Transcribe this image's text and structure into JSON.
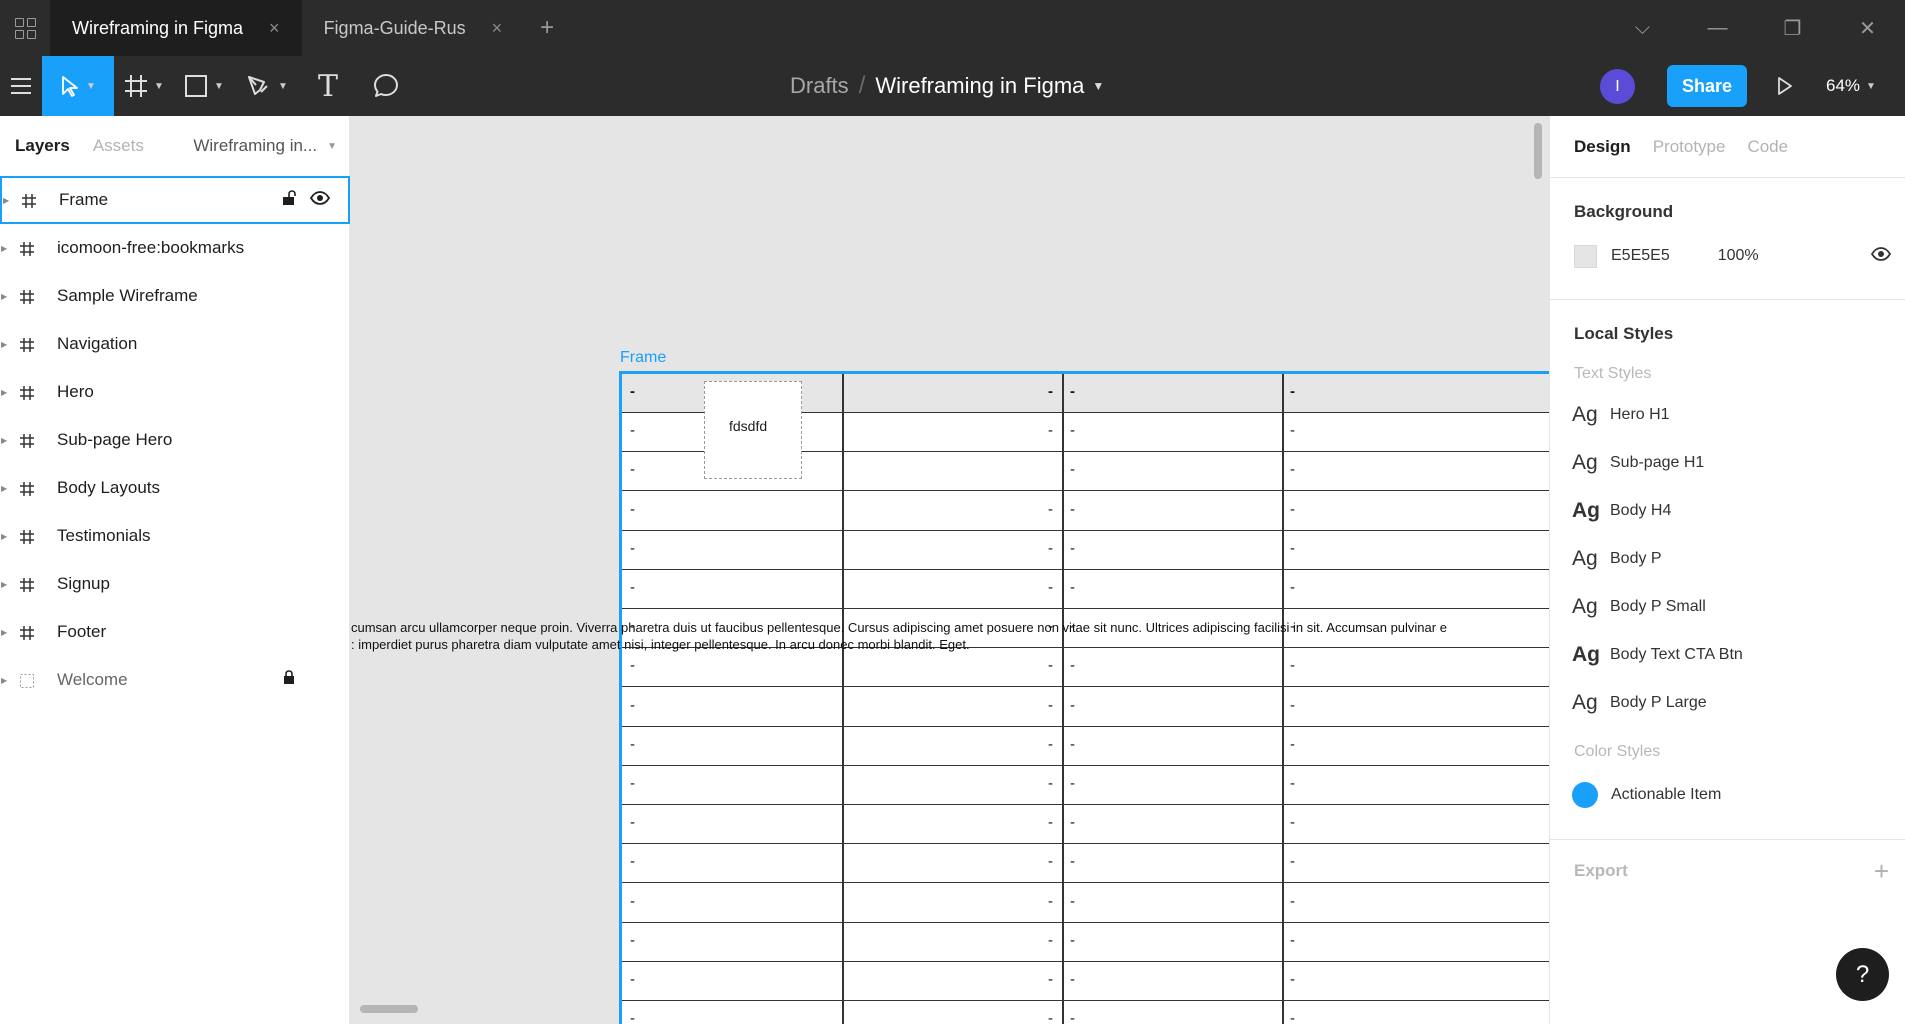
{
  "titlebar": {
    "tabs": [
      {
        "label": "Wireframing in Figma",
        "active": true
      },
      {
        "label": "Figma-Guide-Rus",
        "active": false
      }
    ],
    "close_glyph": "×",
    "plus_glyph": "+",
    "window_controls": {
      "chevron": "⌵",
      "minimize": "—",
      "restore": "❐",
      "close": "✕"
    }
  },
  "toolbar": {
    "breadcrumb": {
      "parent": "Drafts",
      "separator": "/",
      "file": "Wireframing in Figma"
    },
    "avatar_letter": "I",
    "share_label": "Share",
    "zoom": "64%",
    "text_tool_glyph": "T",
    "accent": "#18a0fb"
  },
  "left_panel": {
    "tabs": {
      "layers": "Layers",
      "assets": "Assets"
    },
    "page_name": "Wireframing in...",
    "layers": [
      {
        "name": "Frame",
        "icon": "hash-icon",
        "selected": true
      },
      {
        "name": "icomoon-free:bookmarks",
        "icon": "hash-icon"
      },
      {
        "name": "Sample Wireframe",
        "icon": "hash-icon"
      },
      {
        "name": "Navigation",
        "icon": "hash-icon"
      },
      {
        "name": "Hero",
        "icon": "hash-icon"
      },
      {
        "name": "Sub-page Hero",
        "icon": "hash-icon"
      },
      {
        "name": "Body Layouts",
        "icon": "hash-icon"
      },
      {
        "name": "Testimonials",
        "icon": "hash-icon"
      },
      {
        "name": "Signup",
        "icon": "hash-icon"
      },
      {
        "name": "Footer",
        "icon": "hash-icon"
      },
      {
        "name": "Welcome",
        "icon": "dashed-frame-icon",
        "locked": true
      }
    ]
  },
  "canvas": {
    "frame_label": "Frame",
    "cell_dash": "-",
    "dashed_box_text": "fdsdfd",
    "lorem_line1": "cumsan arcu ullamcorper neque proin. Viverra pharetra duis ut faucibus pellentesque. Cursus adipiscing amet posuere non vitae sit nunc. Ultrices adipiscing facilisi in sit. Accumsan pulvinar e",
    "lorem_line2": ": imperdiet purus pharetra diam vulputate amet nisi, integer pellentesque. In arcu donec morbi blandit. Eget."
  },
  "right_panel": {
    "tabs": {
      "design": "Design",
      "prototype": "Prototype",
      "code": "Code"
    },
    "background": {
      "title": "Background",
      "hex": "E5E5E5",
      "opacity": "100%",
      "swatch_color": "#e5e5e5"
    },
    "local_styles": {
      "title": "Local Styles",
      "text_styles_label": "Text Styles",
      "ag": "Ag",
      "text_styles": [
        {
          "name": "Hero H1",
          "bold": false
        },
        {
          "name": "Sub-page H1",
          "bold": false
        },
        {
          "name": "Body H4",
          "bold": true
        },
        {
          "name": "Body P",
          "bold": false
        },
        {
          "name": "Body P Small",
          "bold": false
        },
        {
          "name": "Body Text CTA Btn",
          "bold": true
        },
        {
          "name": "Body P Large",
          "bold": false
        }
      ],
      "color_styles_label": "Color Styles",
      "color_style": {
        "name": "Actionable Item",
        "color": "#18a0fb"
      }
    },
    "export": {
      "title": "Export",
      "plus": "+"
    },
    "help": "?"
  }
}
